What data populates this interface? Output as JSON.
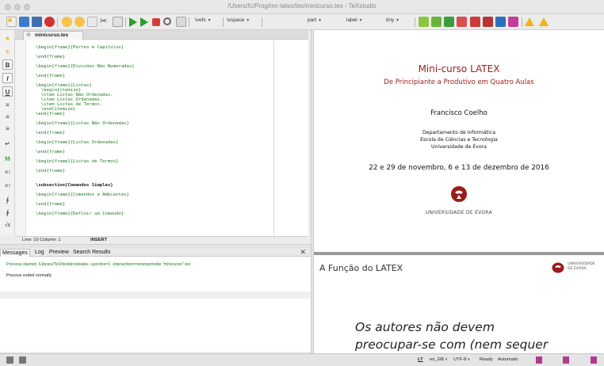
{
  "window": {
    "title": "/Users/fc/Prog/mc-latex/tex/minicurso.tex - TeXstudio"
  },
  "toolbar": {
    "vefx_label": "\\vefx",
    "vspace_label": "\\vspace",
    "part_label": "part",
    "label_label": "label",
    "tiny_label": "tiny"
  },
  "editor": {
    "tab_label": "minicurso.tex",
    "tab_close_glyph": "⊗",
    "lines": {
      "l1": "\\begin{frame}{Partes e Capítulos}",
      "l2": "\\end{frame}",
      "l3": "\\begin{frame}{Divisões Não Numeradas}",
      "l4": "\\end{frame}",
      "l5": "\\begin{frame}{Listas}",
      "l6": "  \\begin{itemize}",
      "l7": "  \\item Listas Não Ordenadas.",
      "l8": "  \\item Listas Ordenadas.",
      "l9": "  \\item Listas de Termos.",
      "l10": "  \\end{itemize}",
      "l11": "\\end{frame}",
      "l12": "\\begin{frame}{Listas Não Ordenadas}",
      "l13": "\\end{frame}",
      "l14": "\\begin{frame}{Listas Ordenadas}",
      "l15": "\\end{frame}",
      "l16": "\\begin{frame}{Listas de Termos}",
      "l17": "\\end{frame}",
      "l18": "\\subsection{Comandos Simples}",
      "l19": "\\begin{frame}{Comandos e Ambientes}",
      "l20": "\\end{frame}",
      "l21": "\\begin{frame}{Definir um Comando}"
    },
    "status_line_col": "Line: 10   Column: 1",
    "status_mode": "INSERT"
  },
  "left_strip": {
    "b1": "B",
    "b2": "I",
    "b3": "U",
    "b4": "≡",
    "b5": "≡",
    "b6": "≡",
    "b7": "↵",
    "b8": "§§",
    "b9": "x□",
    "b10": "x□",
    "b11": "∮",
    "b12": "∲",
    "b13": "√x"
  },
  "bottom_panel": {
    "tab_messages": "Messages",
    "tab_log": "Log",
    "tab_preview": "Preview",
    "tab_search": "Search Results",
    "close_glyph": "✕",
    "msg_started": "Process started: /Library/TeX/texbin/xelatex -synctex=1 -interaction=nonstopmode \"minicurso\".tex",
    "msg_exited": "Process exited normally"
  },
  "viewer": {
    "slide1": {
      "title": "Mini-curso LATEX",
      "subtitle": "De Principiante a Produtivo em Quatro Aulas",
      "author": "Francisco Coelho",
      "inst1": "Departamento de Informática",
      "inst2": "Escola de Ciências e Tecnologia",
      "inst3": "Universidade de Évora",
      "date": "22 e 29 de novembro, 6 e 13 de dezembro de 2016",
      "university": "UNIVERSIDADE DE ÉVORA"
    },
    "slide2": {
      "title": "A Função do LATEX",
      "uni_line1": "UNIVERSIDADE",
      "uni_line2": "DE ÉVORA",
      "body_line1": "Os autores não devem",
      "body_line2": "preocupar-se com (nem sequer"
    }
  },
  "statusbar": {
    "lt_label": "LT",
    "lang_label": "en_GB",
    "encoding_label": "UTF-8",
    "ready_label": "Ready",
    "automatic_label": "Automatic"
  },
  "colors": {
    "accent_red": "#9b1c1c",
    "code_keyword": "#00008b",
    "code_arg": "#1f7a1f",
    "compile_green": "#2e9c2e",
    "stop_red": "#d63b3b"
  }
}
